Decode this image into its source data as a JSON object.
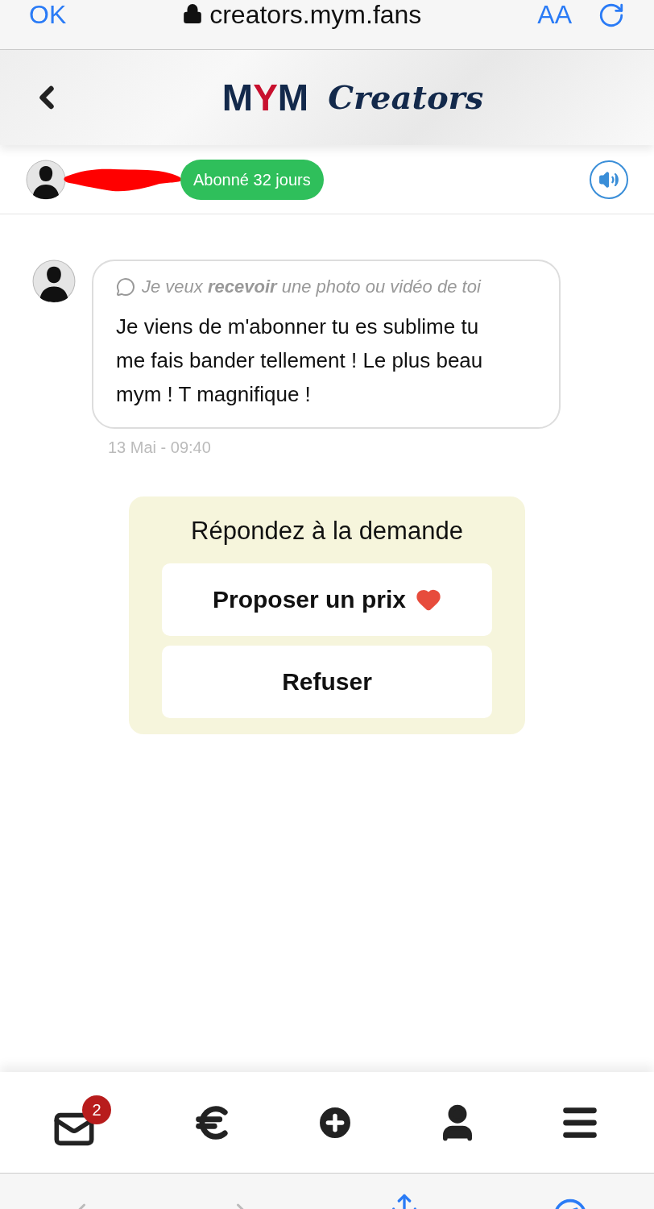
{
  "browser": {
    "done": "OK",
    "url": "creators.mym.fans",
    "text_size": "AA"
  },
  "header": {
    "logo_parts": [
      {
        "text": "M",
        "color": "#13294b"
      },
      {
        "text": "Y",
        "color": "#c8102e"
      },
      {
        "text": "M",
        "color": "#13294b"
      }
    ],
    "logo_suffix": "Creators"
  },
  "subscriber": {
    "badge": "Abonné 32 jours",
    "sound_on": true
  },
  "message": {
    "request": "Je veux **recevoir** une photo ou vidéo de toi",
    "text": "Je viens de m'abonner tu es sublime tu me fais bander tellement ! Le plus beau mym ! T magnifique !",
    "time": "13 Mai - 09:40"
  },
  "response": {
    "title": "Répondez à la demande",
    "buttons": [
      {
        "label": "Proposer un prix",
        "heart": true
      },
      {
        "label": "Refuser",
        "heart": false
      }
    ]
  },
  "nav": [
    {
      "kind": "mail",
      "badge": "2"
    },
    {
      "kind": "euro"
    },
    {
      "kind": "plus"
    },
    {
      "kind": "user"
    },
    {
      "kind": "menu"
    }
  ]
}
